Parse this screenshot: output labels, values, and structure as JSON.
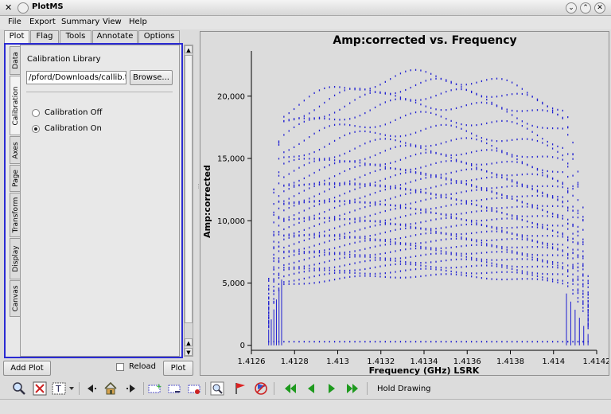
{
  "window": {
    "title": "PlotMS",
    "controls": [
      "⌄",
      "⌃",
      "✕"
    ]
  },
  "menu": [
    "File",
    "Export",
    "Summary",
    "View",
    "Help"
  ],
  "top_tabs": [
    "Plot",
    "Flag",
    "Tools",
    "Annotate",
    "Options"
  ],
  "side_tabs": [
    "Data",
    "Calibration",
    "Axes",
    "Page",
    "Transform",
    "Display",
    "Canvas"
  ],
  "calibration": {
    "section_label": "Calibration Library",
    "file_value": "/pford/Downloads/callib.txt",
    "browse_label": "Browse...",
    "off_label": "Calibration Off",
    "on_label": "Calibration On",
    "selected": "on"
  },
  "bottom_buttons": {
    "add_plot": "Add Plot",
    "reload": "Reload",
    "plot": "Plot"
  },
  "toolbar": {
    "hold_drawing": "Hold Drawing"
  },
  "chart_data": {
    "type": "scatter",
    "title": "Amp:corrected vs. Frequency",
    "xlabel": "Frequency (GHz) LSRK",
    "ylabel": "Amp:corrected",
    "xlim": [
      1.4126,
      1.4142
    ],
    "ylim": [
      -400,
      23500
    ],
    "xticks": [
      1.4126,
      1.4128,
      1.413,
      1.4132,
      1.4134,
      1.4136,
      1.4138,
      1.414,
      1.4142
    ],
    "xtick_labels": [
      "1.4126",
      "1.4128",
      "1.413",
      "1.4132",
      "1.4134",
      "1.4136",
      "1.4138",
      "1.414",
      "1.4142"
    ],
    "yticks": [
      0,
      5000,
      10000,
      15000,
      20000
    ],
    "ytick_labels": [
      "0",
      "5,000",
      "10,000",
      "15,000",
      "20,000"
    ],
    "grid": false,
    "color": "#1f1fd1",
    "channel_range": [
      1.41268,
      1.41416
    ],
    "flat_band": [
      1.41274,
      1.41406
    ],
    "row_levels": [
      300,
      5600,
      6000,
      6400,
      6800,
      7200,
      7600,
      8000,
      8400,
      8800,
      9200,
      9600,
      10000,
      10400,
      10800,
      11200,
      11600,
      12000,
      12400,
      12800,
      13200,
      13600,
      14000,
      14500,
      15100,
      15700,
      16400,
      17300,
      18300,
      19400,
      20200,
      20900,
      21600
    ]
  },
  "colors": {
    "panel_frame": "#2b2bd3",
    "marker": "#1f1fd1",
    "play_green": "#1e9a1e"
  }
}
